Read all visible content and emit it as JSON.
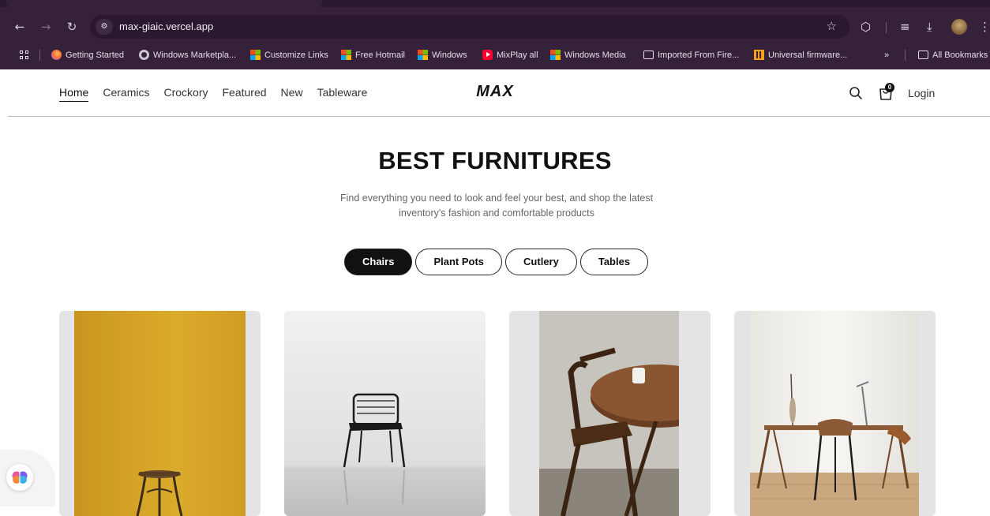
{
  "browser": {
    "url": "max-giaic.vercel.app",
    "bookmarks": [
      {
        "label": "Getting Started",
        "icon": "firefox-icon"
      },
      {
        "label": "Windows Marketpla...",
        "icon": "globe-icon"
      },
      {
        "label": "Customize Links",
        "icon": "microsoft-icon"
      },
      {
        "label": "Free Hotmail",
        "icon": "microsoft-icon"
      },
      {
        "label": "Windows",
        "icon": "microsoft-icon"
      },
      {
        "label": "MixPlay all",
        "icon": "youtube-icon"
      },
      {
        "label": "Windows Media",
        "icon": "microsoft-icon"
      },
      {
        "label": "Imported From Fire...",
        "icon": "folder-icon"
      },
      {
        "label": "Universal firmware...",
        "icon": "app-icon"
      }
    ],
    "overflow": "»",
    "all_bookmarks": "All Bookmarks"
  },
  "nav": {
    "links": [
      "Home",
      "Ceramics",
      "Crockory",
      "Featured",
      "New",
      "Tableware"
    ],
    "active": "Home",
    "logo": "MAX",
    "cart_count": "0",
    "login": "Login"
  },
  "hero": {
    "title": "BEST FURNITURES",
    "subtitle": "Find everything you need to look and feel your best, and shop the latest inventory's fashion and comfortable products"
  },
  "filters": {
    "items": [
      "Chairs",
      "Plant Pots",
      "Cutlery",
      "Tables"
    ],
    "selected": "Chairs"
  },
  "products": [
    {
      "image": "yellow-wall-stool-photo"
    },
    {
      "image": "wire-chair-photo"
    },
    {
      "image": "wooden-chair-round-table-photo"
    },
    {
      "image": "desk-and-chair-photo"
    }
  ],
  "colors": {
    "chrome": "#35213a",
    "accent": "#111111",
    "card_bg": "#e4e4e7"
  }
}
